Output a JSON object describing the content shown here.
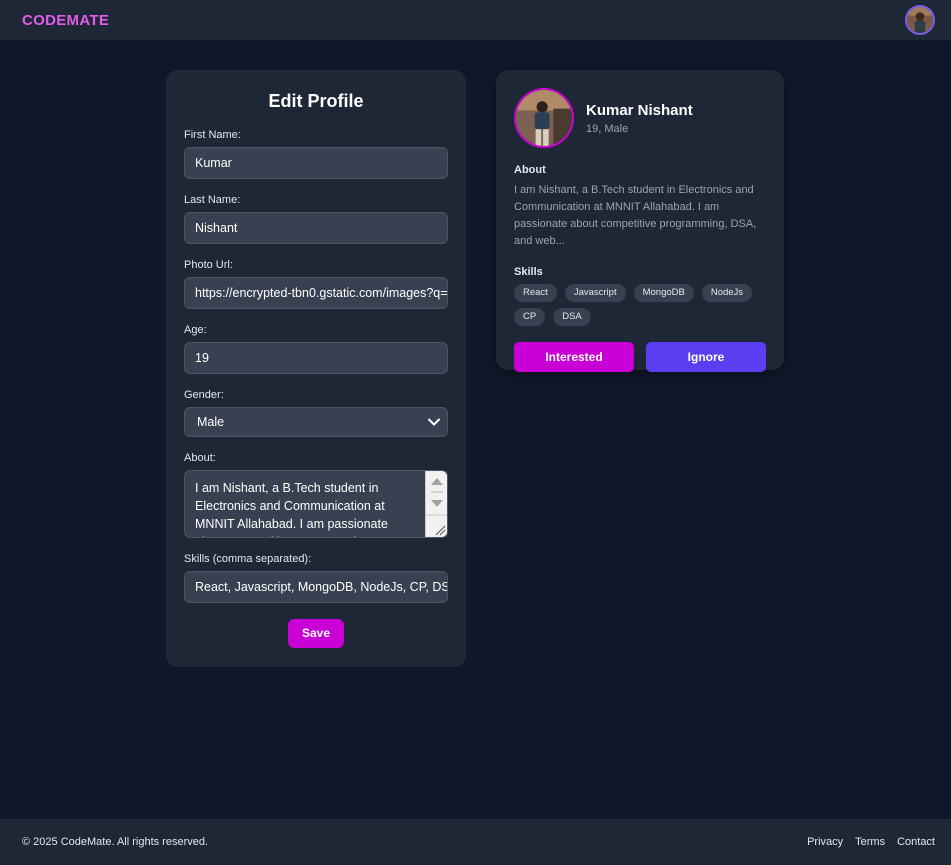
{
  "navbar": {
    "brand": "CODEMATE",
    "avatar_icon": "user-avatar-photo"
  },
  "edit_profile": {
    "title": "Edit Profile",
    "first_name": {
      "label": "First Name:",
      "value": "Kumar"
    },
    "last_name": {
      "label": "Last Name:",
      "value": "Nishant"
    },
    "photo_url": {
      "label": "Photo Url:",
      "value": "https://encrypted-tbn0.gstatic.com/images?q="
    },
    "age": {
      "label": "Age:",
      "value": "19"
    },
    "gender": {
      "label": "Gender:",
      "value": "Male"
    },
    "about": {
      "label": "About:",
      "value": "I am Nishant, a B.Tech student in Electronics and Communication at MNNIT Allahabad. I am passionate about competitive programming, DSA, and web..."
    },
    "skills": {
      "label": "Skills (comma separated):",
      "value": "React, Javascript, MongoDB, NodeJs, CP, DSA"
    },
    "save_label": "Save"
  },
  "profile_card": {
    "name": "Kumar Nishant",
    "subtitle": "19, Male",
    "about_title": "About",
    "about_text": "I am Nishant, a B.Tech student in Electronics and Communication at MNNIT Allahabad. I am passionate about competitive programming, DSA, and web...",
    "skills_title": "Skills",
    "skills": [
      "React",
      "Javascript",
      "MongoDB",
      "NodeJs",
      "CP",
      "DSA"
    ],
    "interested_label": "Interested",
    "ignore_label": "Ignore"
  },
  "footer": {
    "copyright": "© 2025 CodeMate. All rights reserved.",
    "links": [
      "Privacy",
      "Terms",
      "Contact"
    ]
  },
  "colors": {
    "background": "#0f172a",
    "panel": "#1e2736",
    "brand": "#e05ce9",
    "interested": "#c800d6",
    "ignore": "#5b3df2"
  }
}
